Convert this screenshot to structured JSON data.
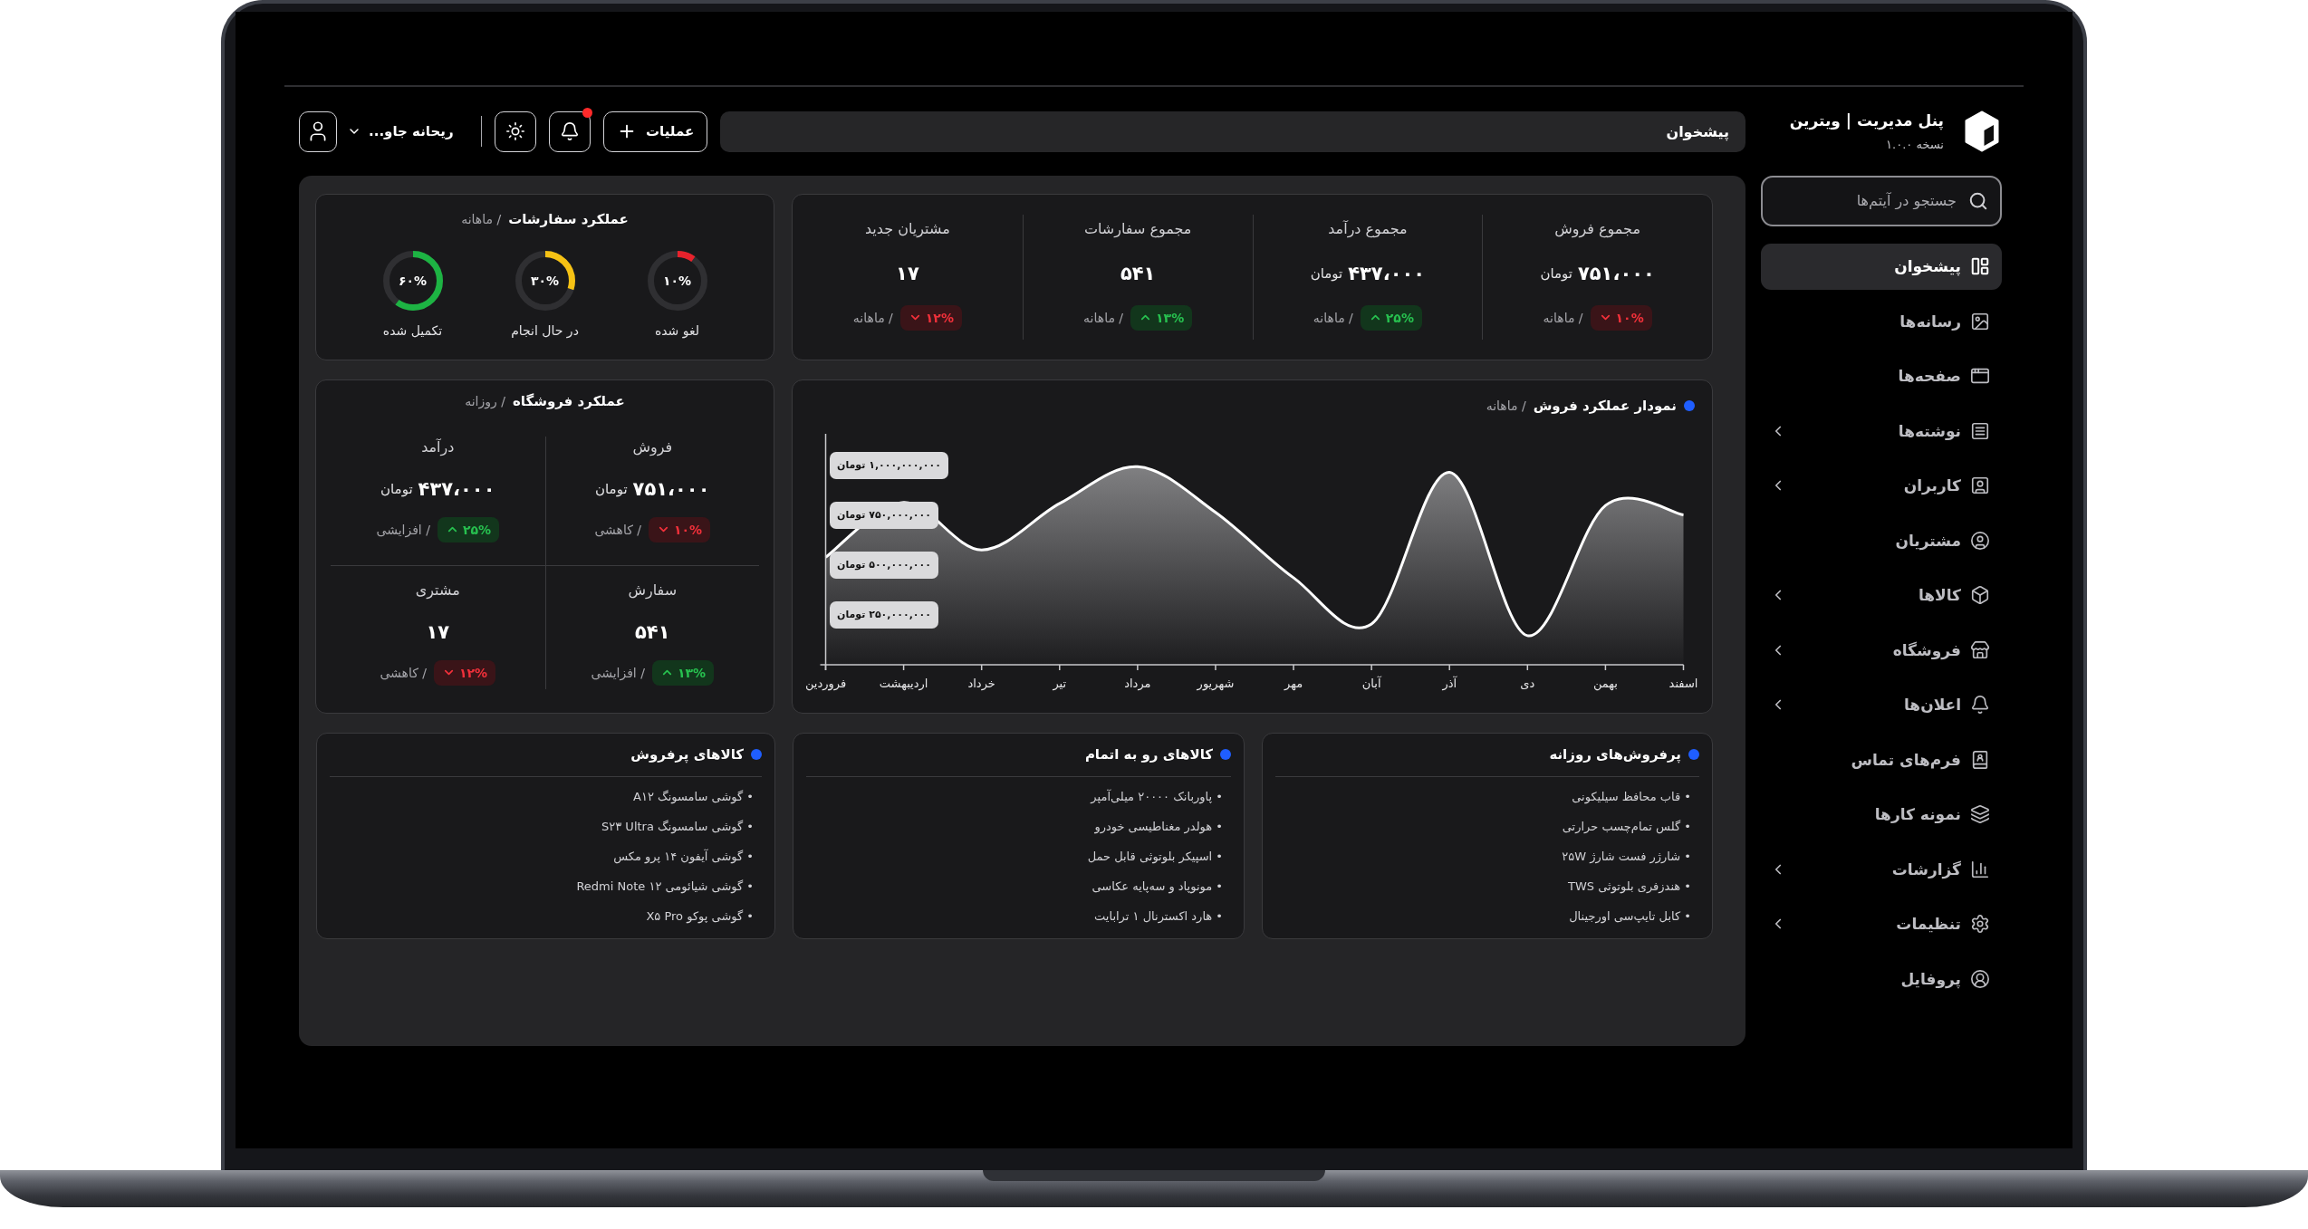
{
  "sidebar": {
    "title": "پنل مدیریت | ویترین",
    "version": "نسخه ۱.۰.۰",
    "search": {
      "placeholder": "جستجو در آیتم‌ها"
    },
    "items": [
      {
        "label": "پیشخوان",
        "selected": true,
        "expandable": false
      },
      {
        "label": "رسانه‌ها",
        "selected": false,
        "expandable": false
      },
      {
        "label": "صفحه‌ها",
        "selected": false,
        "expandable": false
      },
      {
        "label": "نوشته‌ها",
        "selected": false,
        "expandable": true
      },
      {
        "label": "کاربران",
        "selected": false,
        "expandable": true
      },
      {
        "label": "مشتریان",
        "selected": false,
        "expandable": false
      },
      {
        "label": "کالاها",
        "selected": false,
        "expandable": true
      },
      {
        "label": "فروشگاه",
        "selected": false,
        "expandable": true
      },
      {
        "label": "اعلان‌ها",
        "selected": false,
        "expandable": true
      },
      {
        "label": "فرم‌های تماس",
        "selected": false,
        "expandable": false
      },
      {
        "label": "نمونه کارها",
        "selected": false,
        "expandable": false
      },
      {
        "label": "گزارشات",
        "selected": false,
        "expandable": true
      },
      {
        "label": "تنظیمات",
        "selected": false,
        "expandable": true
      },
      {
        "label": "پروفایل",
        "selected": false,
        "expandable": false
      }
    ]
  },
  "header": {
    "breadcrumb": "پیشخوان",
    "actions_label": "عملیات",
    "notifications_unread": true,
    "user_name": "ریحانه جاو..."
  },
  "stats": [
    {
      "title": "مجموع فروش",
      "value": "۷۵۱،۰۰۰",
      "unit": "تومان",
      "change": "۱۰%",
      "rising": false,
      "period": "/ ماهانه"
    },
    {
      "title": "مجموع درآمد",
      "value": "۴۳۷،۰۰۰",
      "unit": "تومان",
      "change": "۲۵%",
      "rising": true,
      "period": "/ ماهانه"
    },
    {
      "title": "مجموع سفارشات",
      "value": "۵۴۱",
      "change": "۱۳%",
      "rising": true,
      "period": "/ ماهانه"
    },
    {
      "title": "مشتریان جدید",
      "value": "۱۷",
      "change": "۱۲%",
      "rising": false,
      "period": "/ ماهانه"
    }
  ],
  "orders_performance": {
    "title": "عملکرد سفارشات",
    "period": "/ ماهانه",
    "rings": [
      {
        "label": "لغو شده",
        "percent": "۱۰%",
        "level": 0.1,
        "color": "#e8222c"
      },
      {
        "label": "در حال انجام",
        "percent": "۳۰%",
        "level": 0.3,
        "color": "#f6c214"
      },
      {
        "label": "تکمیل شده",
        "percent": "۶۰%",
        "level": 0.6,
        "color": "#1db343"
      }
    ]
  },
  "sales_chart": {
    "period": "/ ماهانه",
    "chart_data": {
      "type": "area",
      "title": "نمودار عملکرد فروش",
      "categories": [
        "فروردین",
        "اردیبهشت",
        "خرداد",
        "تیر",
        "مرداد",
        "شهریور",
        "مهر",
        "آبان",
        "آذر",
        "دی",
        "بهمن",
        "اسفند"
      ],
      "series": [
        {
          "color": "#ffffff",
          "values": [
            540000000,
            815000000,
            577000000,
            810000000,
            995000000,
            765000000,
            437000000,
            205000000,
            967000000,
            146000000,
            800000000,
            753000000
          ]
        }
      ],
      "ylim": [
        0,
        1160000000
      ],
      "yticks": [
        {
          "value": 250000000,
          "label": "۲۵۰,۰۰۰,۰۰۰ تومان"
        },
        {
          "value": 500000000,
          "label": "۵۰۰,۰۰۰,۰۰۰ تومان"
        },
        {
          "value": 750000000,
          "label": "۷۵۰,۰۰۰,۰۰۰ تومان"
        },
        {
          "value": 1000000000,
          "label": "۱,۰۰۰,۰۰۰,۰۰۰ تومان"
        }
      ]
    }
  },
  "store_performance": {
    "title": "عملکرد فروشگاه",
    "period": "/ روزانه",
    "cells": [
      {
        "label": "فروش",
        "value": "۷۵۱،۰۰۰",
        "unit": "تومان",
        "change": "۱۰%",
        "rising": false,
        "trend_label": "/ کاهشی"
      },
      {
        "label": "درآمد",
        "value": "۴۳۷،۰۰۰",
        "unit": "تومان",
        "change": "۲۵%",
        "rising": true,
        "trend_label": "/ افزایشی"
      },
      {
        "label": "سفارش",
        "value": "۵۴۱",
        "change": "۱۳%",
        "rising": true,
        "trend_label": "/ افزایشی"
      },
      {
        "label": "مشتری",
        "value": "۱۷",
        "change": "۱۲%",
        "rising": false,
        "trend_label": "/ کاهشی"
      }
    ]
  },
  "lists": [
    {
      "title": "پرفروش‌های روزانه",
      "items": [
        "• قاب محافظ سیلیکونی",
        "• گلس تمام‌چسب حرارتی",
        "• شارژر فست شارژ ۲۵W",
        "• هندزفری بلوتوثی TWS",
        "• کابل تایپ‌سی اورجینال"
      ]
    },
    {
      "title": "کالاهای رو به اتمام",
      "items": [
        "• پاوربانک ۲۰۰۰۰ میلی‌آمپر",
        "• هولدر مغناطیسی خودرو",
        "• اسپیکر بلوتوثی قابل حمل",
        "• مونوپاد و سه‌پایه عکاسی",
        "• هارد اکسترنال ۱ ترابایت"
      ]
    },
    {
      "title": "کالاهای پرفروش",
      "items": [
        "• گوشی سامسونگ A۱۲",
        "• گوشی سامسونگ S۲۳ Ultra",
        "• گوشی آیفون ۱۴ پرو مکس",
        "• گوشی شیائومی Redmi Note ۱۲",
        "• گوشی پوکو X۵ Pro"
      ]
    }
  ]
}
